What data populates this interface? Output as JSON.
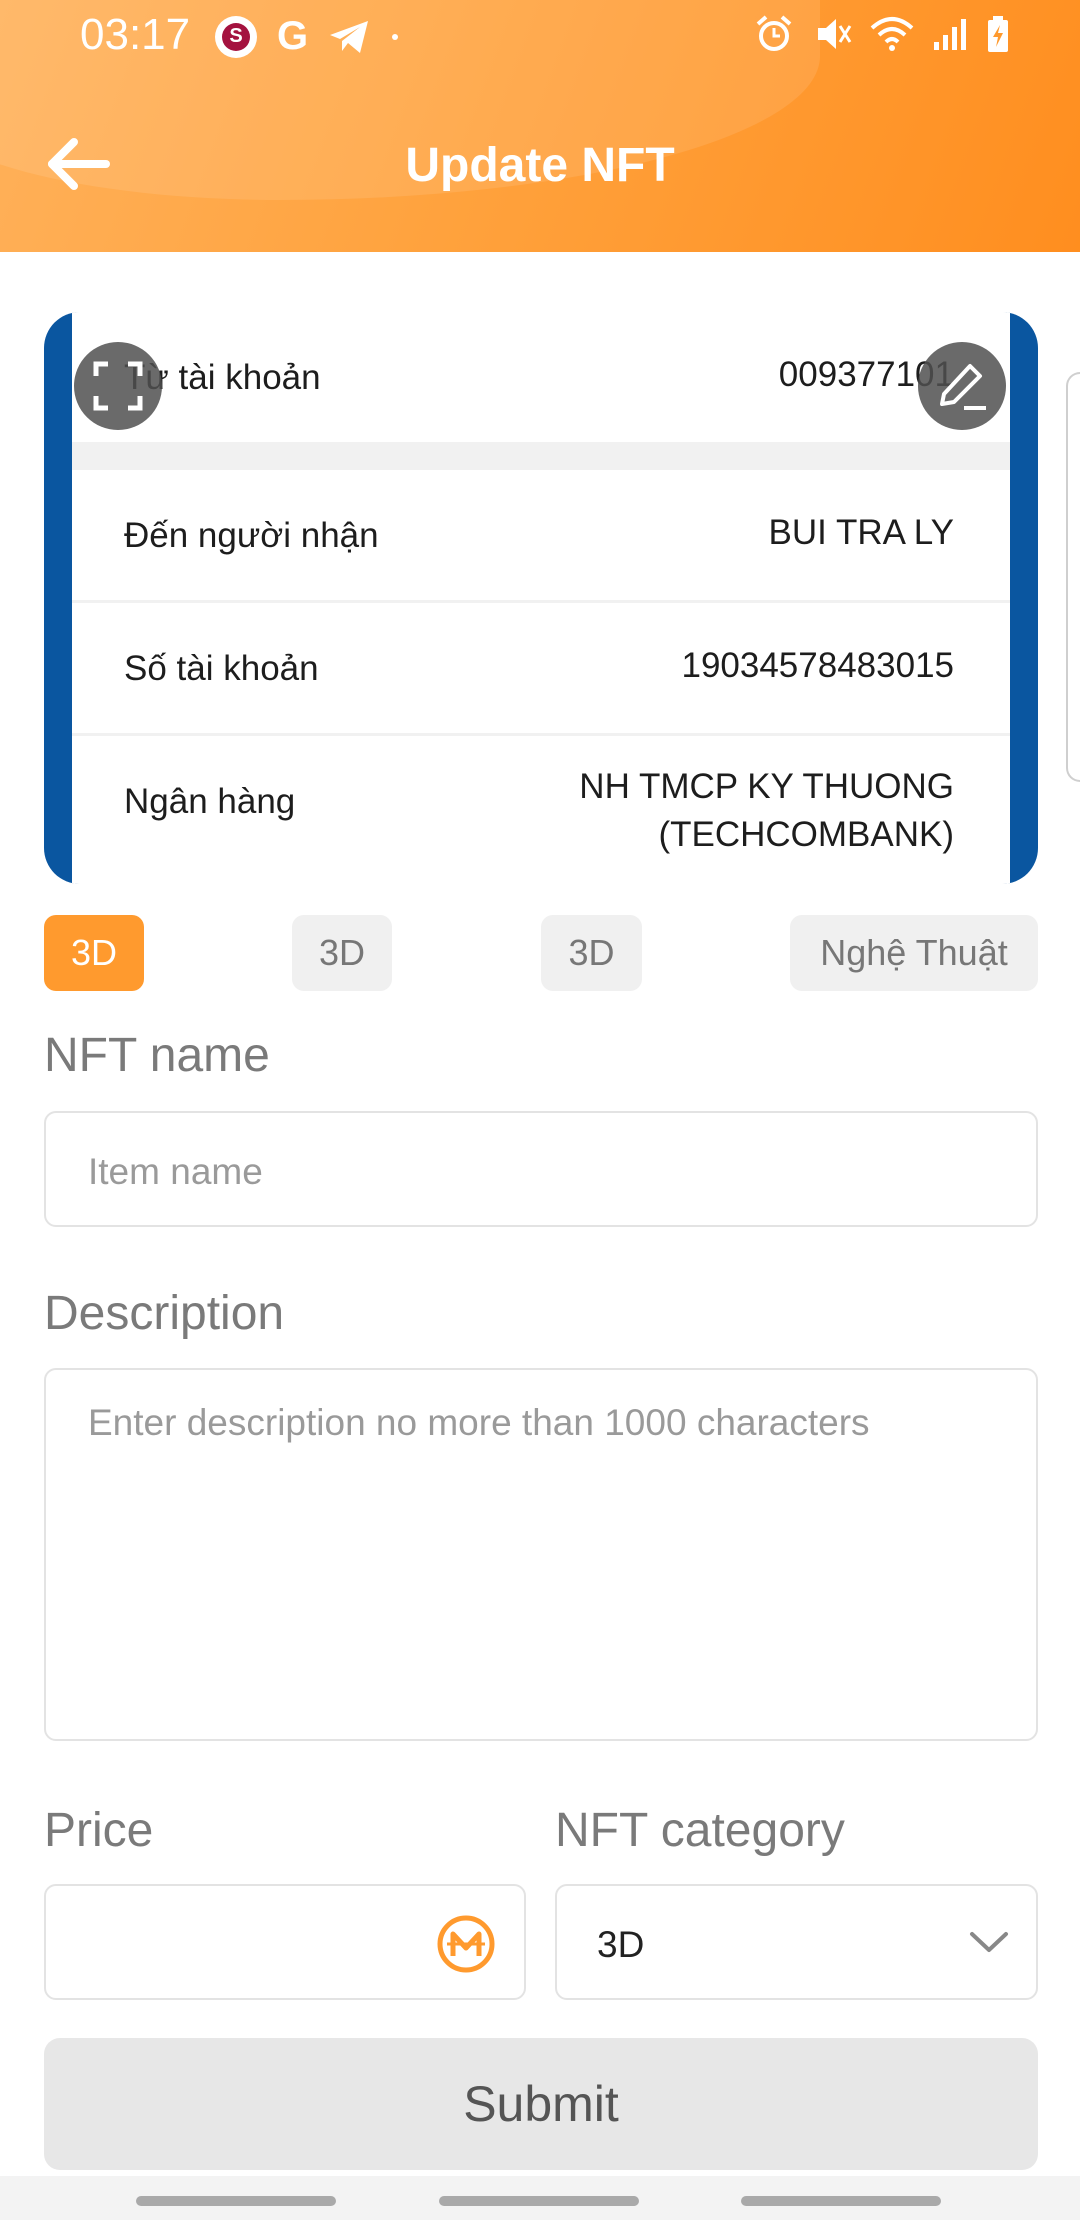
{
  "status_bar": {
    "time": "03:17",
    "left_icons": [
      "s-app-icon",
      "g-app-icon",
      "telegram-icon",
      "dot-icon"
    ],
    "right_icons": [
      "alarm-icon",
      "mute-icon",
      "wifi-icon",
      "signal-icon",
      "battery-charging-icon"
    ]
  },
  "header": {
    "title": "Update NFT",
    "back_icon": "arrow-left-icon",
    "gradient_colors": [
      "#ffb15a",
      "#ff8e1f"
    ]
  },
  "preview": {
    "rows": [
      {
        "label": "Từ tài khoản",
        "value": "009377101"
      },
      {
        "label": "Đến người nhận",
        "value": "BUI TRA LY"
      },
      {
        "label": "Số tài khoản",
        "value": "19034578483015"
      },
      {
        "label": "Ngân hàng",
        "value": "NH TMCP KY THUONG",
        "value2": "(TECHCOMBANK)"
      }
    ],
    "fullscreen_icon": "fullscreen-icon",
    "edit_icon": "pencil-edit-icon",
    "frame_color": "#0a56a0"
  },
  "chips": [
    {
      "label": "3D",
      "active": true
    },
    {
      "label": "3D",
      "active": false
    },
    {
      "label": "3D",
      "active": false
    },
    {
      "label": "Nghệ Thuật",
      "active": false
    }
  ],
  "form": {
    "name_label": "NFT name",
    "name_placeholder": "Item name",
    "description_label": "Description",
    "description_placeholder": "Enter description no more than 1000 characters",
    "price_label": "Price",
    "price_value": "",
    "price_icon": "coin-m-icon",
    "category_label": "NFT category",
    "category_value": "3D",
    "category_icon": "chevron-down-icon"
  },
  "submit_label": "Submit",
  "accent_color": "#ff9a2e"
}
